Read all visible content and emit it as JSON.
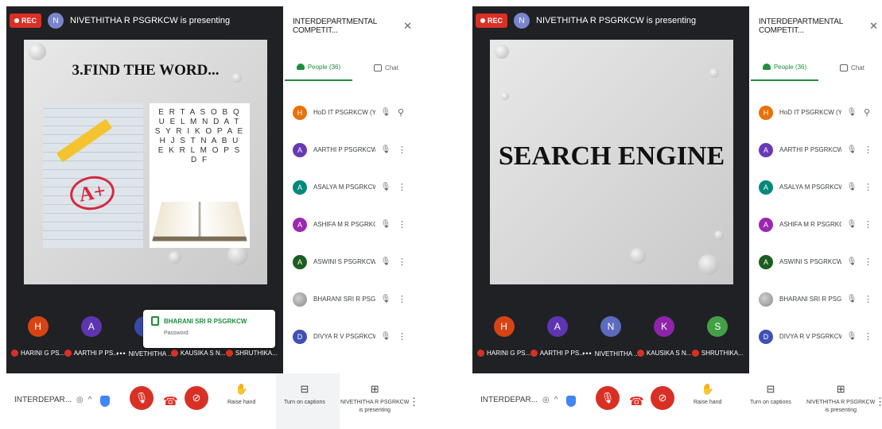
{
  "panels": [
    {
      "rec_label": "REC",
      "presenter_initial": "N",
      "presenter_text": "NIVETHITHA R PSGRKCW is presenting",
      "slide_title": "3.FIND THE WORD...",
      "slide_grade": "A+",
      "slide_letters": "E R T A S O B Q U E L M N D A T S Y R I K O P A E H J S T N A B U E K R L M O P S D F",
      "sidebar_title": "INTERDEPARTMENTAL COMPETIT...",
      "close_glyph": "✕",
      "tab_people": "People (36)",
      "tab_chat": "Chat",
      "participants": [
        {
          "initial": "H",
          "name": "HoD IT PSGRKCW (You)",
          "color": "#e8710a"
        },
        {
          "initial": "A",
          "name": "AARTHI P PSGRKCW",
          "color": "#673ab7"
        },
        {
          "initial": "A",
          "name": "ASALYA M PSGRKCW",
          "color": "#00897b"
        },
        {
          "initial": "A",
          "name": "ASHIFA M R PSGRKCW",
          "color": "#9c27b0"
        },
        {
          "initial": "A",
          "name": "ASWINI S PSGRKCW",
          "color": "#1b5e20"
        },
        {
          "initial": "",
          "name": "BHARANI SRI R PSGRKC...",
          "color": "#9e9e9e"
        },
        {
          "initial": "D",
          "name": "DIVYA R V PSGRKCW",
          "color": "#3f51b5"
        }
      ],
      "tiles": [
        {
          "initial": "H",
          "color": "#d84315",
          "label": "HARINI G PS..."
        },
        {
          "initial": "A",
          "color": "#5e35b1",
          "label": "AARTHI P PS..."
        },
        {
          "initial": "",
          "color": "#3949ab",
          "label": "NIVETHITHA ..."
        },
        {
          "initial": "",
          "color": "#8e24aa",
          "label": "KAUSIKA S N..."
        },
        {
          "initial": "",
          "color": "#43a047",
          "label": "SHRUTHIKA..."
        }
      ],
      "toast_name": "BHARANI SRI R PSGRKCW",
      "toast_sub": "Password",
      "meeting_name": "INTERDEPAR...",
      "raise_hand": "Raise hand",
      "captions": "Turn on captions",
      "presenting_line1": "NIVETHITHA R PSGRKCW",
      "presenting_line2": "is presenting"
    },
    {
      "rec_label": "REC",
      "presenter_initial": "N",
      "presenter_text": "NIVETHITHA R PSGRKCW is presenting",
      "slide_title": "SEARCH ENGINE",
      "sidebar_title": "INTERDEPARTMENTAL COMPETIT...",
      "close_glyph": "✕",
      "tab_people": "People (36)",
      "tab_chat": "Chat",
      "participants": [
        {
          "initial": "H",
          "name": "HoD IT PSGRKCW (You)",
          "color": "#e8710a"
        },
        {
          "initial": "A",
          "name": "AARTHI P PSGRKCW",
          "color": "#673ab7"
        },
        {
          "initial": "A",
          "name": "ASALYA M PSGRKCW",
          "color": "#00897b"
        },
        {
          "initial": "A",
          "name": "ASHIFA M R PSGRKCW",
          "color": "#9c27b0"
        },
        {
          "initial": "A",
          "name": "ASWINI S PSGRKCW",
          "color": "#1b5e20"
        },
        {
          "initial": "",
          "name": "BHARANI SRI R PSGRKC...",
          "color": "#9e9e9e"
        },
        {
          "initial": "D",
          "name": "DIVYA R V PSGRKCW",
          "color": "#3f51b5"
        }
      ],
      "tiles": [
        {
          "initial": "H",
          "color": "#d84315",
          "label": "HARINI G PS..."
        },
        {
          "initial": "A",
          "color": "#5e35b1",
          "label": "AARTHI P PS..."
        },
        {
          "initial": "N",
          "color": "#5c6bc0",
          "label": "NIVETHITHA ..."
        },
        {
          "initial": "K",
          "color": "#8e24aa",
          "label": "KAUSIKA S N..."
        },
        {
          "initial": "S",
          "color": "#43a047",
          "label": "SHRUTHIKA..."
        }
      ],
      "meeting_name": "INTERDEPAR...",
      "raise_hand": "Raise hand",
      "captions": "Turn on captions",
      "presenting_line1": "NIVETHITHA R PSGRKCW",
      "presenting_line2": "is presenting"
    }
  ]
}
